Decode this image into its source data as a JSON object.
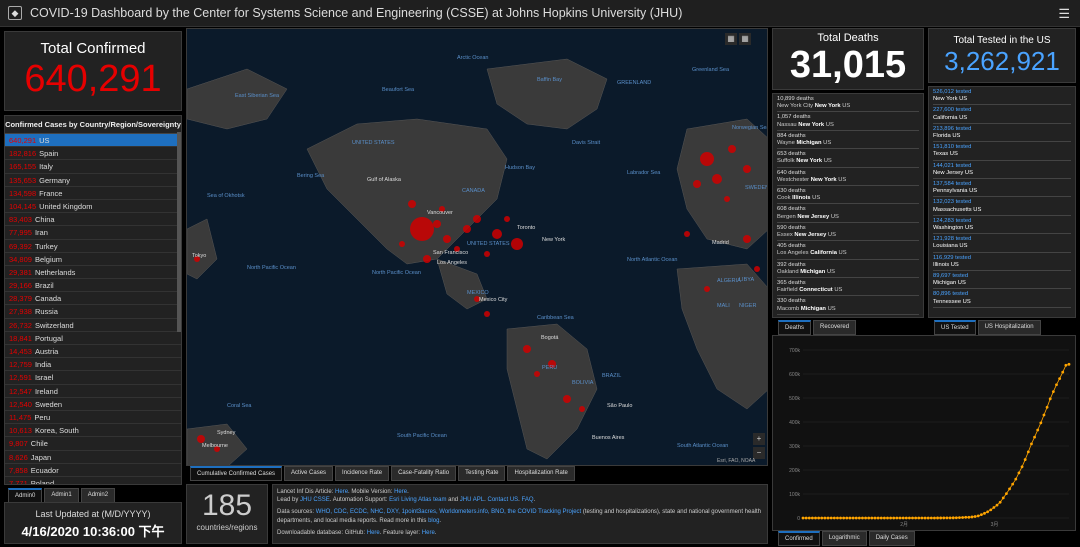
{
  "header": {
    "title": "COVID-19 Dashboard by the Center for Systems Science and Engineering (CSSE) at Johns Hopkins University (JHU)"
  },
  "confirmed": {
    "label": "Total Confirmed",
    "value": "640,291"
  },
  "country_list": {
    "header": "Confirmed Cases by Country/Region/Sovereignty",
    "rows": [
      {
        "n": "640,291",
        "c": "US"
      },
      {
        "n": "182,816",
        "c": "Spain"
      },
      {
        "n": "165,155",
        "c": "Italy"
      },
      {
        "n": "135,653",
        "c": "Germany"
      },
      {
        "n": "134,598",
        "c": "France"
      },
      {
        "n": "104,145",
        "c": "United Kingdom"
      },
      {
        "n": "83,403",
        "c": "China"
      },
      {
        "n": "77,995",
        "c": "Iran"
      },
      {
        "n": "69,392",
        "c": "Turkey"
      },
      {
        "n": "34,809",
        "c": "Belgium"
      },
      {
        "n": "29,381",
        "c": "Netherlands"
      },
      {
        "n": "29,166",
        "c": "Brazil"
      },
      {
        "n": "28,379",
        "c": "Canada"
      },
      {
        "n": "27,938",
        "c": "Russia"
      },
      {
        "n": "26,732",
        "c": "Switzerland"
      },
      {
        "n": "18,841",
        "c": "Portugal"
      },
      {
        "n": "14,453",
        "c": "Austria"
      },
      {
        "n": "12,759",
        "c": "India"
      },
      {
        "n": "12,591",
        "c": "Israel"
      },
      {
        "n": "12,547",
        "c": "Ireland"
      },
      {
        "n": "12,540",
        "c": "Sweden"
      },
      {
        "n": "11,475",
        "c": "Peru"
      },
      {
        "n": "10,613",
        "c": "Korea, South"
      },
      {
        "n": "9,807",
        "c": "Chile"
      },
      {
        "n": "8,626",
        "c": "Japan"
      },
      {
        "n": "7,858",
        "c": "Ecuador"
      },
      {
        "n": "7,771",
        "c": "Poland"
      }
    ]
  },
  "admin_tabs": [
    "Admin0",
    "Admin1",
    "Admin2"
  ],
  "updated": {
    "label": "Last Updated at (M/D/YYYY)",
    "value": "4/16/2020 10:36:00 下午"
  },
  "map": {
    "labels": [
      "Arctic Ocean",
      "GREENLAND",
      "Baffin Bay",
      "Greenland Sea",
      "Beaufort Sea",
      "UNITED STATES",
      "CANADA",
      "Hudson Bay",
      "Davis Strait",
      "Labrador Sea",
      "Bering Sea",
      "Gulf of Alaska",
      "Sea of Okhotsk",
      "East Siberian Sea",
      "Norwegian Sea",
      "SWEDEN",
      "Vancouver",
      "Toronto",
      "New York",
      "Madrid",
      "UNITED STATES",
      "San Francisco",
      "Los Angeles",
      "Tokyo",
      "North Pacific Ocean",
      "North Pacific Ocean",
      "North Atlantic Ocean",
      "MEXICO",
      "Mexico City",
      "ALGERIA",
      "LIBYA",
      "MALI",
      "NIGER",
      "Caribbean Sea",
      "Bogotá",
      "PERU",
      "BOLIVIA",
      "BRAZIL",
      "São Paulo",
      "Buenos Aires",
      "South Pacific Ocean",
      "South Atlantic Ocean",
      "Coral Sea",
      "Sydney",
      "Melbourne"
    ],
    "attribution": "Esri, FAO, NOAA"
  },
  "map_tabs": [
    "Cumulative Confirmed Cases",
    "Active Cases",
    "Incidence Rate",
    "Case-Fatality Ratio",
    "Testing Rate",
    "Hospitalization Rate"
  ],
  "countries": {
    "value": "185",
    "label": "countries/regions"
  },
  "info": {
    "l1a": "Lancet Inf Dis Article: ",
    "l1b": "Here",
    "l1c": ". Mobile Version: ",
    "l1d": "Here",
    "l1e": ".",
    "l2a": "Lead by ",
    "l2b": "JHU CSSE",
    "l2c": ". Automation Support: ",
    "l2d": "Esri Living Atlas team",
    "l2e": " and ",
    "l2f": "JHU APL",
    "l2g": ". ",
    "l2h": "Contact US",
    "l2i": ". ",
    "l2j": "FAQ",
    "l2k": ".",
    "l3a": "Data sources: ",
    "l3b": "WHO, CDC, ECDC, NHC, DXY, 1point3acres, Worldometers.info, BNO, the COVID Tracking Project",
    "l3c": " (testing and hospitalizations), state and national government health departments, and local media reports.  Read more in this ",
    "l3d": "blog",
    "l3e": ".",
    "l4a": "Downloadable database: GitHub: ",
    "l4b": "Here",
    "l4c": ". Feature layer: ",
    "l4d": "Here",
    "l4e": "."
  },
  "deaths": {
    "label": "Total Deaths",
    "value": "31,015",
    "items": [
      {
        "v": "10,899 deaths",
        "pre": "New York City ",
        "b": "New York",
        "post": " US"
      },
      {
        "v": "1,057 deaths",
        "pre": "Nassau ",
        "b": "New York",
        "post": " US"
      },
      {
        "v": "884 deaths",
        "pre": "Wayne ",
        "b": "Michigan",
        "post": " US"
      },
      {
        "v": "653 deaths",
        "pre": "Suffolk ",
        "b": "New York",
        "post": " US"
      },
      {
        "v": "640 deaths",
        "pre": "Westchester ",
        "b": "New York",
        "post": " US"
      },
      {
        "v": "630 deaths",
        "pre": "Cook ",
        "b": "Illinois",
        "post": " US"
      },
      {
        "v": "608 deaths",
        "pre": "Bergen ",
        "b": "New Jersey",
        "post": " US"
      },
      {
        "v": "590 deaths",
        "pre": "Essex ",
        "b": "New Jersey",
        "post": " US"
      },
      {
        "v": "405 deaths",
        "pre": "Los Angeles ",
        "b": "California",
        "post": " US"
      },
      {
        "v": "392 deaths",
        "pre": "Oakland ",
        "b": "Michigan",
        "post": " US"
      },
      {
        "v": "365 deaths",
        "pre": "Fairfield ",
        "b": "Connecticut",
        "post": " US"
      },
      {
        "v": "330 deaths",
        "pre": "Macomb ",
        "b": "Michigan",
        "post": " US"
      }
    ],
    "tabs": [
      "Deaths",
      "Recovered"
    ]
  },
  "tested": {
    "label": "Total Tested in the US",
    "value": "3,262,921",
    "items": [
      {
        "v": "526,012 tested",
        "p": "New York US"
      },
      {
        "v": "227,600 tested",
        "p": "California US"
      },
      {
        "v": "213,896 tested",
        "p": "Florida US"
      },
      {
        "v": "151,810 tested",
        "p": "Texas US"
      },
      {
        "v": "144,021 tested",
        "p": "New Jersey US"
      },
      {
        "v": "137,584 tested",
        "p": "Pennsylvania US"
      },
      {
        "v": "132,023 tested",
        "p": "Massachusetts US"
      },
      {
        "v": "124,283 tested",
        "p": "Washington US"
      },
      {
        "v": "121,928 tested",
        "p": "Louisiana US"
      },
      {
        "v": "116,929 tested",
        "p": "Illinois US"
      },
      {
        "v": "89,697 tested",
        "p": "Michigan US"
      },
      {
        "v": "80,896 tested",
        "p": "Tennessee US"
      }
    ],
    "tabs": [
      "US Tested",
      "US Hospitalization"
    ]
  },
  "chart_tabs": [
    "Confirmed",
    "Logarithmic",
    "Daily Cases"
  ],
  "chart_data": {
    "type": "line",
    "ytick_labels": [
      "0",
      "100k",
      "200k",
      "300k",
      "400k",
      "500k",
      "600k",
      "700k"
    ],
    "xtick_labels": [
      "2月",
      "3月"
    ],
    "ylim": [
      0,
      700000
    ],
    "x": [
      0,
      1,
      2,
      3,
      4,
      5,
      6,
      7,
      8,
      9,
      10,
      11,
      12,
      13,
      14,
      15,
      16,
      17,
      18,
      19,
      20,
      21,
      22,
      23,
      24,
      25,
      26,
      27,
      28,
      29,
      30,
      31,
      32,
      33,
      34,
      35,
      36,
      37,
      38,
      39,
      40,
      41,
      42,
      43,
      44,
      45,
      46,
      47,
      48,
      49,
      50,
      51,
      52,
      53,
      54,
      55,
      56,
      57,
      58,
      59,
      60,
      61,
      62,
      63,
      64,
      65,
      66,
      67,
      68,
      69,
      70,
      71,
      72,
      73,
      74,
      75,
      76,
      77,
      78,
      79,
      80,
      81,
      82,
      83,
      84,
      85
    ],
    "values": [
      1,
      1,
      2,
      2,
      5,
      5,
      5,
      5,
      5,
      7,
      8,
      8,
      11,
      11,
      11,
      11,
      11,
      11,
      11,
      11,
      12,
      12,
      13,
      13,
      13,
      13,
      13,
      13,
      13,
      13,
      15,
      15,
      15,
      15,
      15,
      15,
      16,
      16,
      24,
      30,
      53,
      73,
      104,
      174,
      222,
      337,
      451,
      519,
      711,
      1109,
      1561,
      2157,
      2870,
      2968,
      4360,
      6141,
      8914,
      14153,
      19479,
      25818,
      33756,
      43847,
      53740,
      65778,
      83836,
      101657,
      121465,
      140909,
      161831,
      188172,
      213372,
      243453,
      275586,
      308850,
      337072,
      366667,
      396223,
      429052,
      461437,
      496535,
      526396,
      555313,
      580619,
      607670,
      636350,
      640291
    ],
    "color": "#ffa500"
  },
  "colors": {
    "accent": "#1e6fbf",
    "confirmed": "#e60000",
    "tested": "#4aa3ff"
  }
}
